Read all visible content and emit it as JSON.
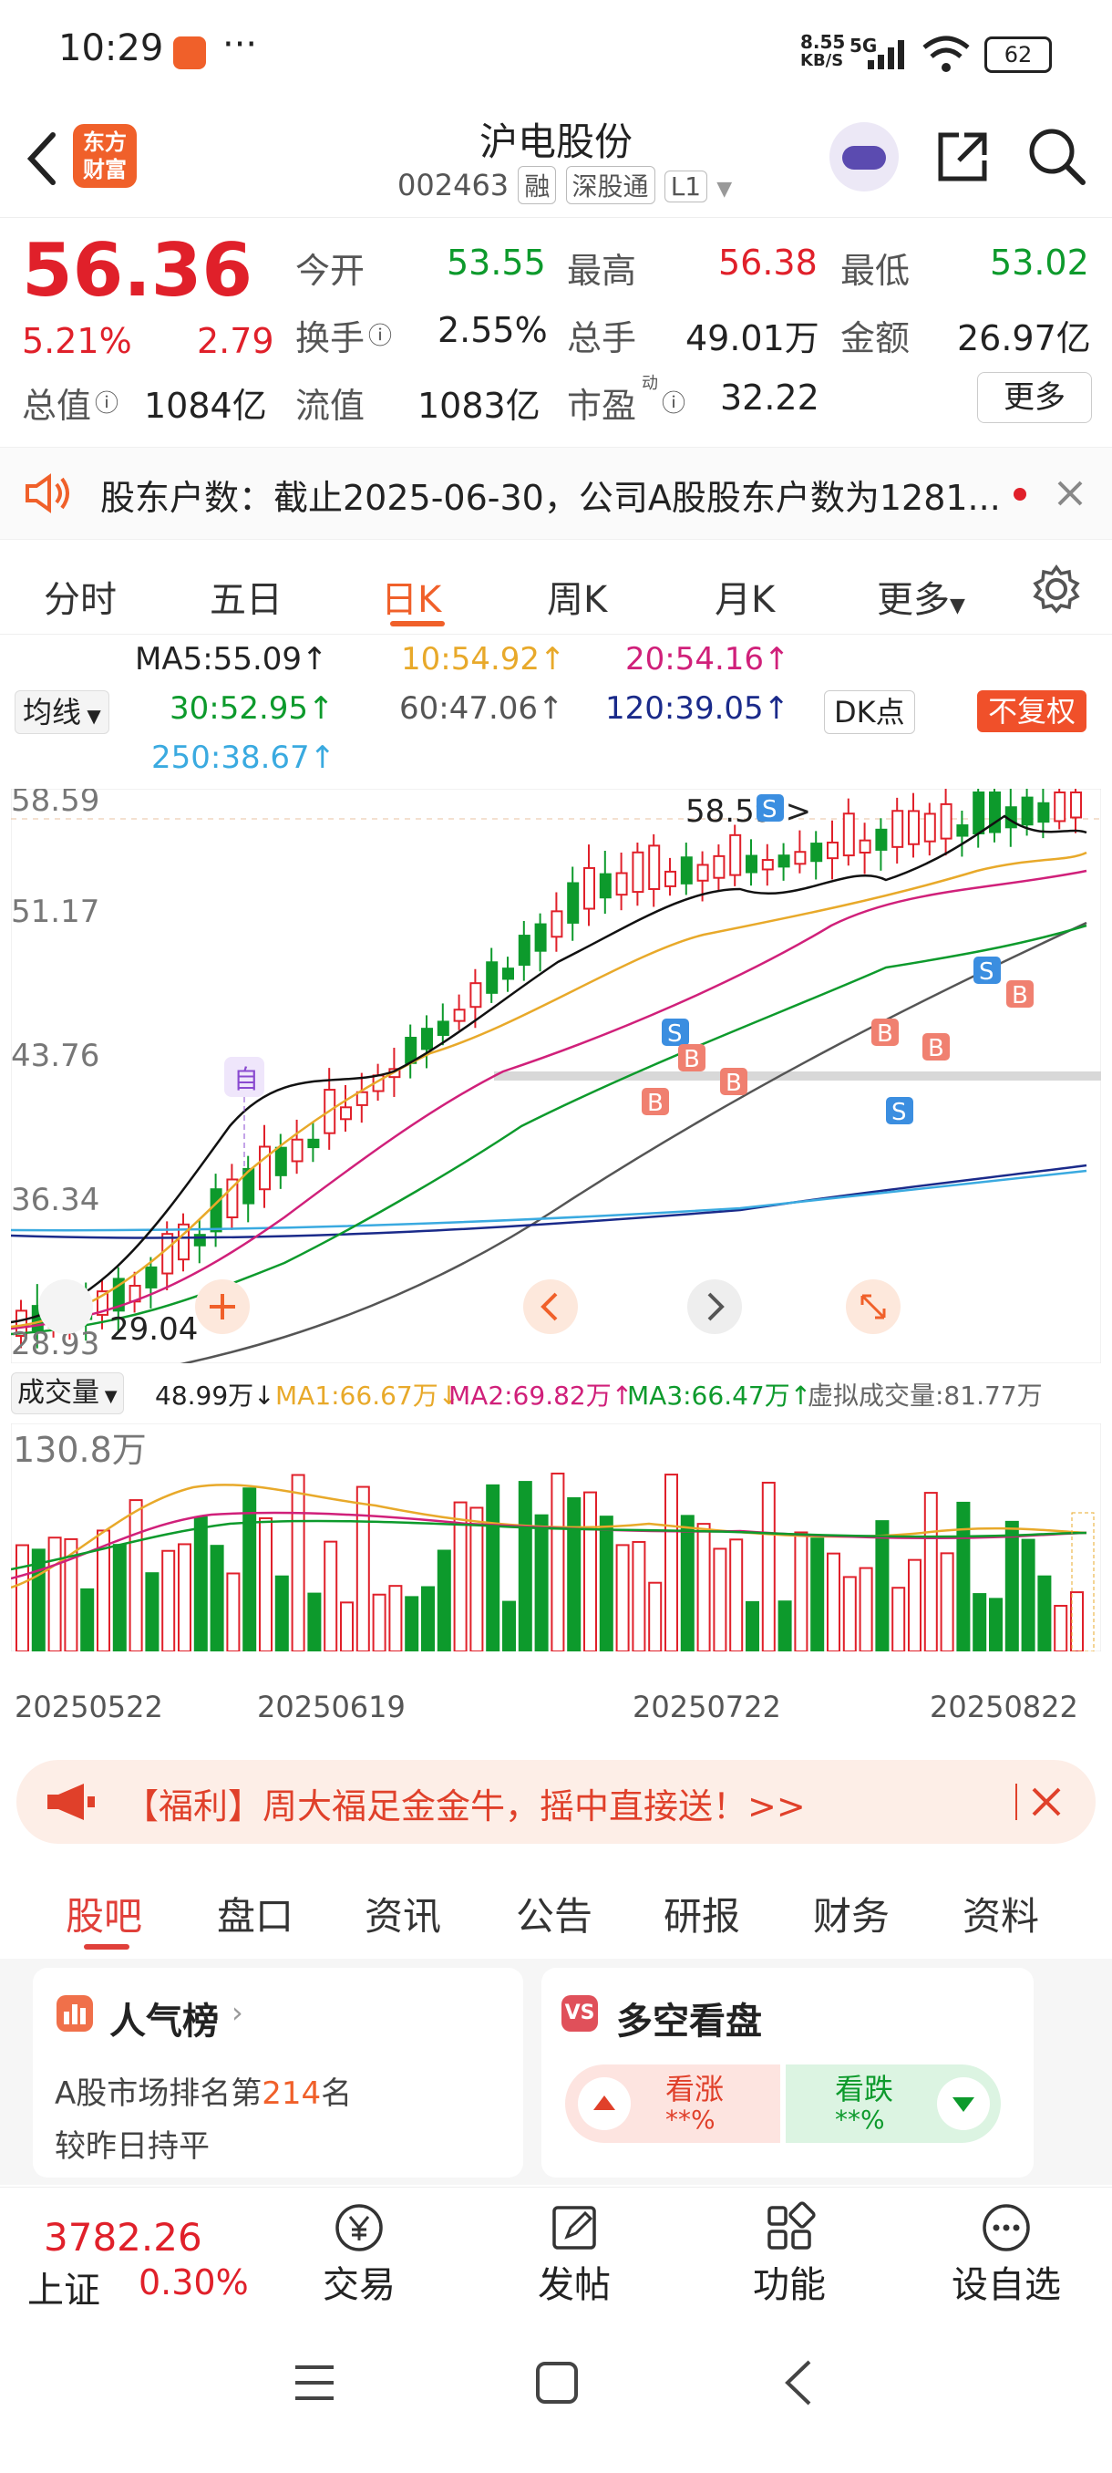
{
  "status": {
    "time": "10:29",
    "dots": "···",
    "net_speed": "8.55",
    "net_unit": "KB/S",
    "net_type": "5G",
    "battery": "62"
  },
  "header": {
    "name": "沪电股份",
    "code": "002463",
    "tag_rong": "融",
    "tag_sgt": "深股通",
    "tag_level": "L1",
    "logo_line1": "东方",
    "logo_line2": "财富"
  },
  "quote": {
    "price": "56.36",
    "change_pct": "5.21%",
    "change": "2.79",
    "open_label": "今开",
    "open": "53.55",
    "high_label": "最高",
    "high": "56.38",
    "low_label": "最低",
    "low": "53.02",
    "turnover_label": "换手",
    "turnover": "2.55%",
    "volume_label": "总手",
    "volume": "49.01万",
    "amount_label": "金额",
    "amount": "26.97亿",
    "mktcap_label": "总值",
    "mktcap": "1084亿",
    "float_label": "流值",
    "float": "1083亿",
    "pe_label": "市盈",
    "pe_sup": "动",
    "pe": "32.22",
    "more_button": "更多"
  },
  "notice": {
    "text": "股东户数：截止2025-06-30，公司A股股东户数为1281..."
  },
  "chart_tabs": {
    "items": [
      "分时",
      "五日",
      "日K",
      "周K",
      "月K",
      "更多"
    ],
    "active": 2
  },
  "ma": {
    "ma_select": "均线",
    "ma5": "MA5:55.09↑",
    "ma10": "10:54.92↑",
    "ma20": "20:54.16↑",
    "ma30": "30:52.95↑",
    "ma60": "60:47.06↑",
    "ma120": "120:39.05↑",
    "ma250": "250:38.67↑",
    "dk_button": "DK点",
    "fq_button": "不复权",
    "colors": {
      "ma5": "#222222",
      "ma10": "#e8a92a",
      "ma20": "#d0207a",
      "ma30": "#0d9a2c",
      "ma60": "#555555",
      "ma120": "#1a2a8a",
      "ma250": "#3aaae0"
    }
  },
  "kline": {
    "y_labels": [
      "58.59",
      "51.17",
      "43.76",
      "36.34",
      "28.93"
    ],
    "max_label": "58.59->",
    "min_label": "29.04",
    "mark_self": "自",
    "mark_s": "S",
    "mark_b": "B"
  },
  "volume": {
    "select": "成交量",
    "value": "48.99万↓",
    "ma1": "MA1:66.67万↓",
    "ma2": "MA2:69.82万↑",
    "ma3": "MA3:66.47万↑",
    "virtual": "虚拟成交量:81.77万",
    "y_label": "130.8万",
    "dates": [
      "20250522",
      "20250619",
      "20250722",
      "20250822"
    ]
  },
  "banner": {
    "text": "【福利】周大福足金金牛，摇中直接送！>>"
  },
  "subtabs": {
    "items": [
      "股吧",
      "盘口",
      "资讯",
      "公告",
      "研报",
      "财务",
      "资料"
    ],
    "active": 0
  },
  "card_popular": {
    "title": "人气榜",
    "line1_prefix": "A股市场排名第",
    "rank": "214",
    "line1_suffix": "名",
    "line2": "较昨日持平"
  },
  "card_bullbear": {
    "title": "多空看盘",
    "up_label": "看涨",
    "up_value": "**%",
    "down_label": "看跌",
    "down_value": "**%"
  },
  "bottom": {
    "index_value": "3782.26",
    "index_name": "上证",
    "index_change": "0.30%",
    "trade": "交易",
    "post": "发帖",
    "function": "功能",
    "watchlist": "设自选"
  }
}
